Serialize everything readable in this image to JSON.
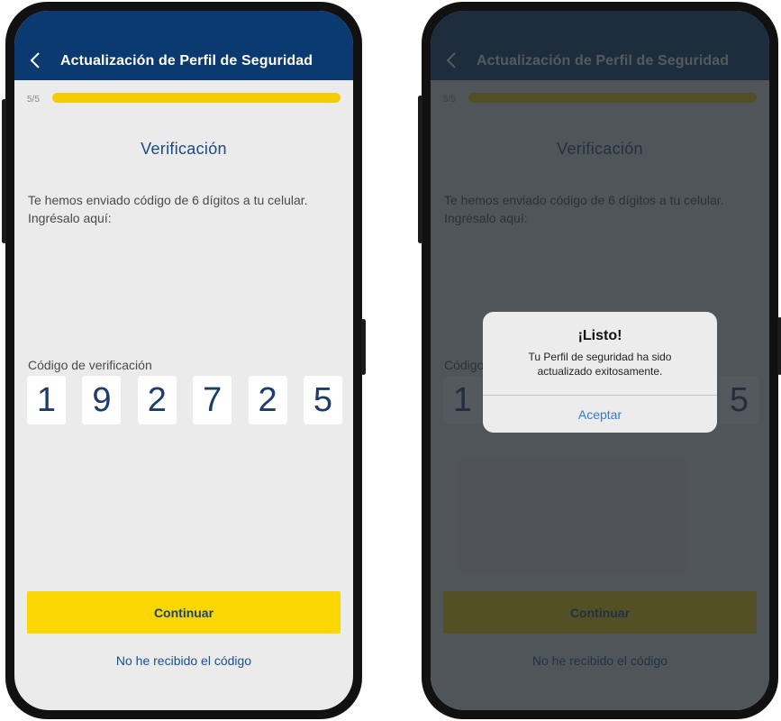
{
  "screen": {
    "header_title": "Actualización de Perfil de Seguridad",
    "step": "5/5",
    "progress": 1.0,
    "section_title": "Verificación",
    "instructions": "Te hemos enviado código de 6 dígitos a tu celular. Ingrésalo aquí:",
    "code_label": "Código de verificación",
    "digits": [
      "1",
      "9",
      "2",
      "7",
      "2",
      "5"
    ],
    "continue_label": "Continuar",
    "resend_label": "No he recibido el código"
  },
  "alert": {
    "title": "¡Listo!",
    "message": "Tu Perfil de seguridad ha sido actualizado exitosamente.",
    "button_label": "Aceptar"
  },
  "icons": {
    "back": "chevron-left-icon"
  },
  "colors": {
    "header": "#0a3a70",
    "accent_yellow": "#fbd600",
    "text_blue": "#1a4a84",
    "link_blue": "#2f7bd9"
  }
}
